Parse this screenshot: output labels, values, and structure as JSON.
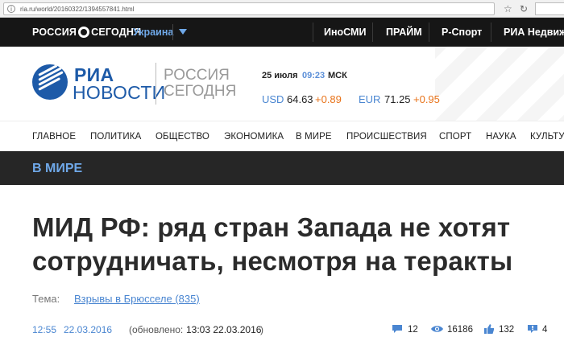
{
  "browser": {
    "url": "ria.ru/world/20160322/1394557841.html"
  },
  "topbar": {
    "logo_left": "РОССИЯ",
    "logo_right": "СЕГОДНЯ",
    "region": "Украина",
    "links": [
      "ИноСМИ",
      "ПРАЙМ",
      "Р-Спорт",
      "РИА Недвиж"
    ]
  },
  "header": {
    "brand_line1": "РИА",
    "brand_line2": "НОВОСТИ",
    "partner_line1": "РОССИЯ",
    "partner_line2": "СЕГОДНЯ",
    "date": "25 июля",
    "time": "09:23",
    "timezone": "МСК",
    "currencies": [
      {
        "code": "USD",
        "value": "64.63",
        "change": "+0.89"
      },
      {
        "code": "EUR",
        "value": "71.25",
        "change": "+0.95"
      }
    ]
  },
  "nav": {
    "items": [
      "ГЛАВНОЕ",
      "ПОЛИТИКА",
      "ОБЩЕСТВО",
      "ЭКОНОМИКА",
      "В МИРЕ",
      "ПРОИСШЕСТВИЯ",
      "СПОРТ",
      "НАУКА",
      "КУЛЬТУ"
    ]
  },
  "section": {
    "title": "В МИРЕ"
  },
  "article": {
    "headline_line1": "МИД РФ: ряд стран Запада не хотят",
    "headline_line2": "сотрудничать, несмотря на теракты",
    "topic_label": "Тема:",
    "topic_link": "Взрывы в Брюсселе (835)",
    "published_time": "12:55",
    "published_date": "22.03.2016",
    "updated_label": "(обновлено:",
    "updated_value": "13:03 22.03.2016",
    "updated_close": ")",
    "stats": {
      "comments": "12",
      "views": "16186",
      "likes": "132",
      "shares": "4"
    }
  },
  "colors": {
    "brand_blue": "#1d5aa8",
    "link_blue": "#4a86d1",
    "accent_orange": "#e8731a",
    "topbar_bg": "#161616",
    "section_bg": "#262626"
  }
}
